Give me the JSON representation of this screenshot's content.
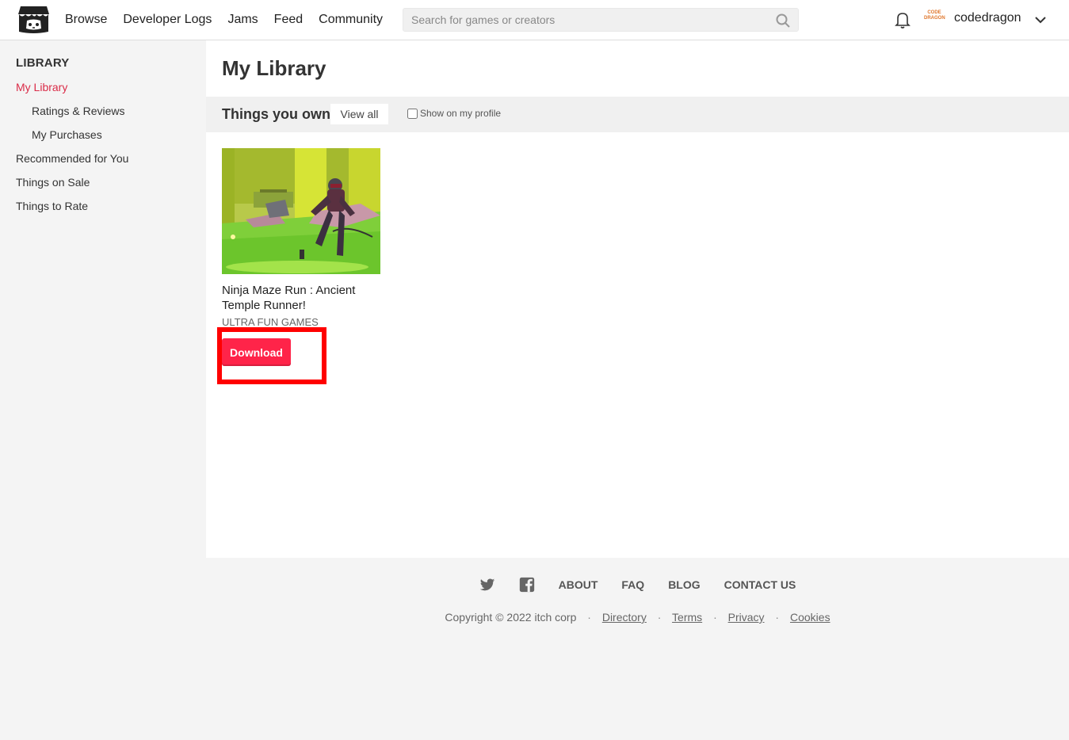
{
  "header": {
    "nav": [
      "Browse",
      "Developer Logs",
      "Jams",
      "Feed",
      "Community"
    ],
    "search_placeholder": "Search for games or creators",
    "avatar_text_top": "CODE",
    "avatar_text_bottom": "DRAGON",
    "username": "codedragon"
  },
  "sidebar": {
    "title": "LIBRARY",
    "items": [
      "My Library",
      "Ratings & Reviews",
      "My Purchases",
      "Recommended for You",
      "Things on Sale",
      "Things to Rate"
    ]
  },
  "main": {
    "title": "My Library",
    "section_title": "Things you own",
    "view_all": "View all",
    "show_profile": "Show on my profile",
    "game": {
      "title": "Ninja Maze Run : Ancient Temple Runner!",
      "author": "ULTRA FUN GAMES",
      "download": "Download"
    }
  },
  "footer": {
    "links": [
      "ABOUT",
      "FAQ",
      "BLOG",
      "CONTACT US"
    ],
    "copyright": "Copyright © 2022 itch corp",
    "bottom_links": [
      "Directory",
      "Terms",
      "Privacy",
      "Cookies"
    ]
  },
  "colors": {
    "accent": "#da2c48",
    "download": "#ff2449",
    "highlight": "#ff0000"
  }
}
